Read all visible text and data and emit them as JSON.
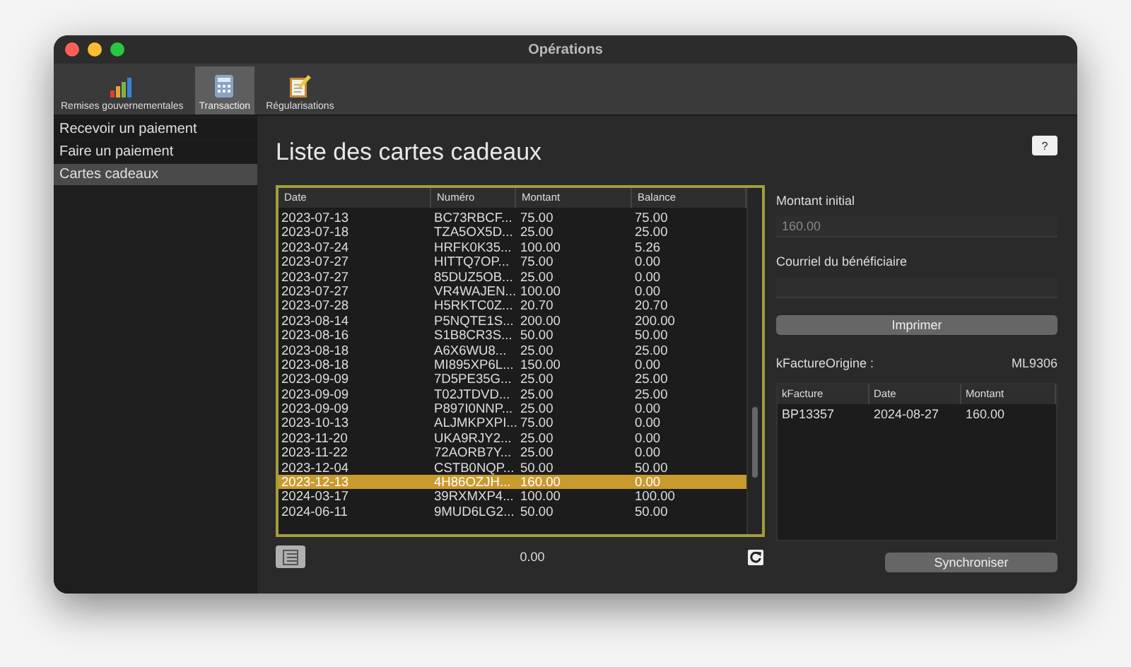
{
  "window": {
    "title": "Opérations"
  },
  "toolbar": [
    {
      "label": "Remises gouvernementales",
      "kind": "chart",
      "selected": false
    },
    {
      "label": "Transaction",
      "kind": "calculator",
      "selected": true
    },
    {
      "label": "Régularisations",
      "kind": "notepad",
      "selected": false
    }
  ],
  "sidebar": {
    "items": [
      {
        "label": "Recevoir un paiement",
        "selected": false
      },
      {
        "label": "Faire un paiement",
        "selected": false
      },
      {
        "label": "Cartes cadeaux",
        "selected": true
      }
    ]
  },
  "heading": "Liste des cartes cadeaux",
  "help_button": "?",
  "table": {
    "columns": [
      "Date",
      "Numéro",
      "Montant",
      "Balance"
    ],
    "rows": [
      {
        "cells": [
          "2023-07-13",
          "BC73RBCF...",
          "75.00",
          "75.00"
        ],
        "selected": false
      },
      {
        "cells": [
          "2023-07-18",
          "TZA5OX5D...",
          "25.00",
          "25.00"
        ],
        "selected": false
      },
      {
        "cells": [
          "2023-07-24",
          "HRFK0K35...",
          "100.00",
          "5.26"
        ],
        "selected": false
      },
      {
        "cells": [
          "2023-07-27",
          "HITTQ7OP...",
          "75.00",
          "0.00"
        ],
        "selected": false
      },
      {
        "cells": [
          "2023-07-27",
          "85DUZ5OB...",
          "25.00",
          "0.00"
        ],
        "selected": false
      },
      {
        "cells": [
          "2023-07-27",
          "VR4WAJEN...",
          "100.00",
          "0.00"
        ],
        "selected": false
      },
      {
        "cells": [
          "2023-07-28",
          "H5RKTC0Z...",
          "20.70",
          "20.70"
        ],
        "selected": false
      },
      {
        "cells": [
          "2023-08-14",
          "P5NQTE1S...",
          "200.00",
          "200.00"
        ],
        "selected": false
      },
      {
        "cells": [
          "2023-08-16",
          "S1B8CR3S...",
          "50.00",
          "50.00"
        ],
        "selected": false
      },
      {
        "cells": [
          "2023-08-18",
          "A6X6WU8...",
          "25.00",
          "25.00"
        ],
        "selected": false
      },
      {
        "cells": [
          "2023-08-18",
          "MI895XP6L...",
          "150.00",
          "0.00"
        ],
        "selected": false
      },
      {
        "cells": [
          "2023-09-09",
          "7D5PE35G...",
          "25.00",
          "25.00"
        ],
        "selected": false
      },
      {
        "cells": [
          "2023-09-09",
          "T02JTDVD...",
          "25.00",
          "25.00"
        ],
        "selected": false
      },
      {
        "cells": [
          "2023-09-09",
          "P897I0NNP...",
          "25.00",
          "0.00"
        ],
        "selected": false
      },
      {
        "cells": [
          "2023-10-13",
          "ALJMKPXPI...",
          "75.00",
          "0.00"
        ],
        "selected": false
      },
      {
        "cells": [
          "2023-11-20",
          "UKA9RJY2...",
          "25.00",
          "0.00"
        ],
        "selected": false
      },
      {
        "cells": [
          "2023-11-22",
          "72AORB7Y...",
          "25.00",
          "0.00"
        ],
        "selected": false
      },
      {
        "cells": [
          "2023-12-04",
          "CSTB0NQP...",
          "50.00",
          "50.00"
        ],
        "selected": false
      },
      {
        "cells": [
          "2023-12-13",
          "4H86OZJH...",
          "160.00",
          "0.00"
        ],
        "selected": true
      },
      {
        "cells": [
          "2024-03-17",
          "39RXMXP4...",
          "100.00",
          "100.00"
        ],
        "selected": false
      },
      {
        "cells": [
          "2024-06-11",
          "9MUD6LG2...",
          "50.00",
          "50.00"
        ],
        "selected": false
      }
    ]
  },
  "total": "0.00",
  "details": {
    "fields": [
      {
        "label": "Montant initial",
        "value": "160.00"
      },
      {
        "label": "Courriel du bénéficiaire"
      }
    ],
    "print_button": "Imprimer",
    "origin": {
      "label": "kFactureOrigine :",
      "value": "ML9306"
    },
    "invoices": {
      "columns": [
        "kFacture",
        "Date",
        "Montant"
      ],
      "rows": [
        [
          "BP13357",
          "2024-08-27",
          "160.00"
        ]
      ]
    },
    "sync_button": "Synchroniser"
  }
}
